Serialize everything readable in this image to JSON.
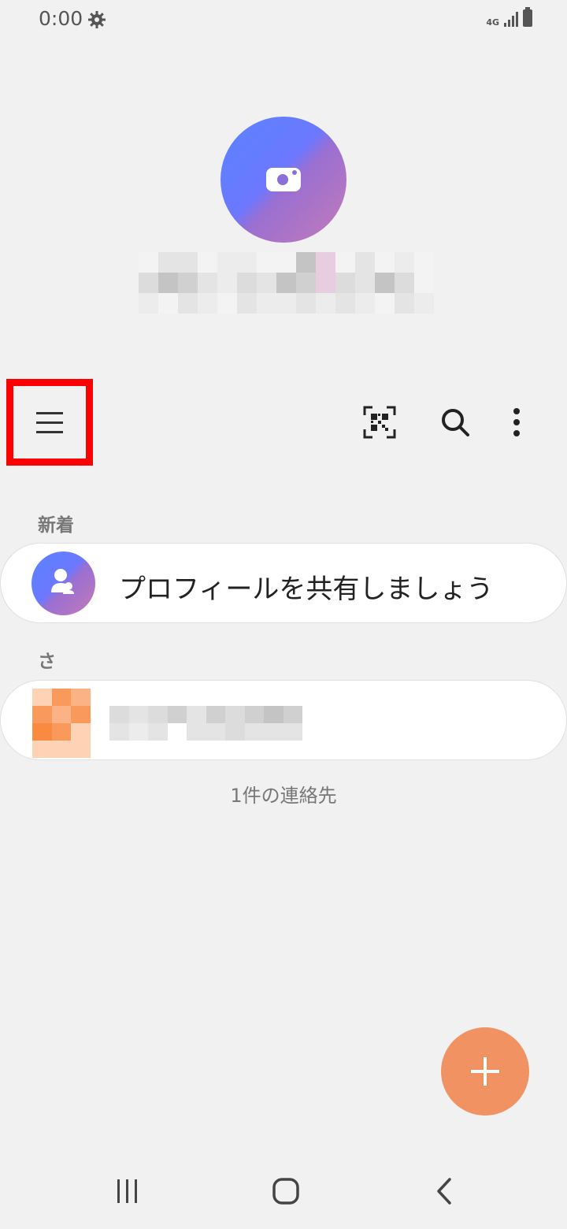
{
  "status_bar": {
    "time": "0:00",
    "network": "4G",
    "icons": [
      "gear-icon",
      "signal-icon",
      "battery-icon"
    ]
  },
  "profile": {
    "avatar_icon": "camera-icon",
    "name_redacted": true
  },
  "toolbar": {
    "menu_icon": "hamburger-icon",
    "qr_icon": "qr-code-icon",
    "search_icon": "search-icon",
    "more_icon": "more-vertical-icon"
  },
  "sections": {
    "new_label": "新着",
    "share_profile_text": "プロフィールを共有しましょう",
    "sa_label": "さ"
  },
  "contact_count": "1件の連絡先",
  "fab": {
    "icon": "plus-icon"
  },
  "nav": {
    "icons": [
      "recent-apps-icon",
      "home-icon",
      "back-icon"
    ]
  },
  "colors": {
    "accent": "#f09261",
    "highlight_box": "#ff0000",
    "background": "#f1f1f1"
  }
}
